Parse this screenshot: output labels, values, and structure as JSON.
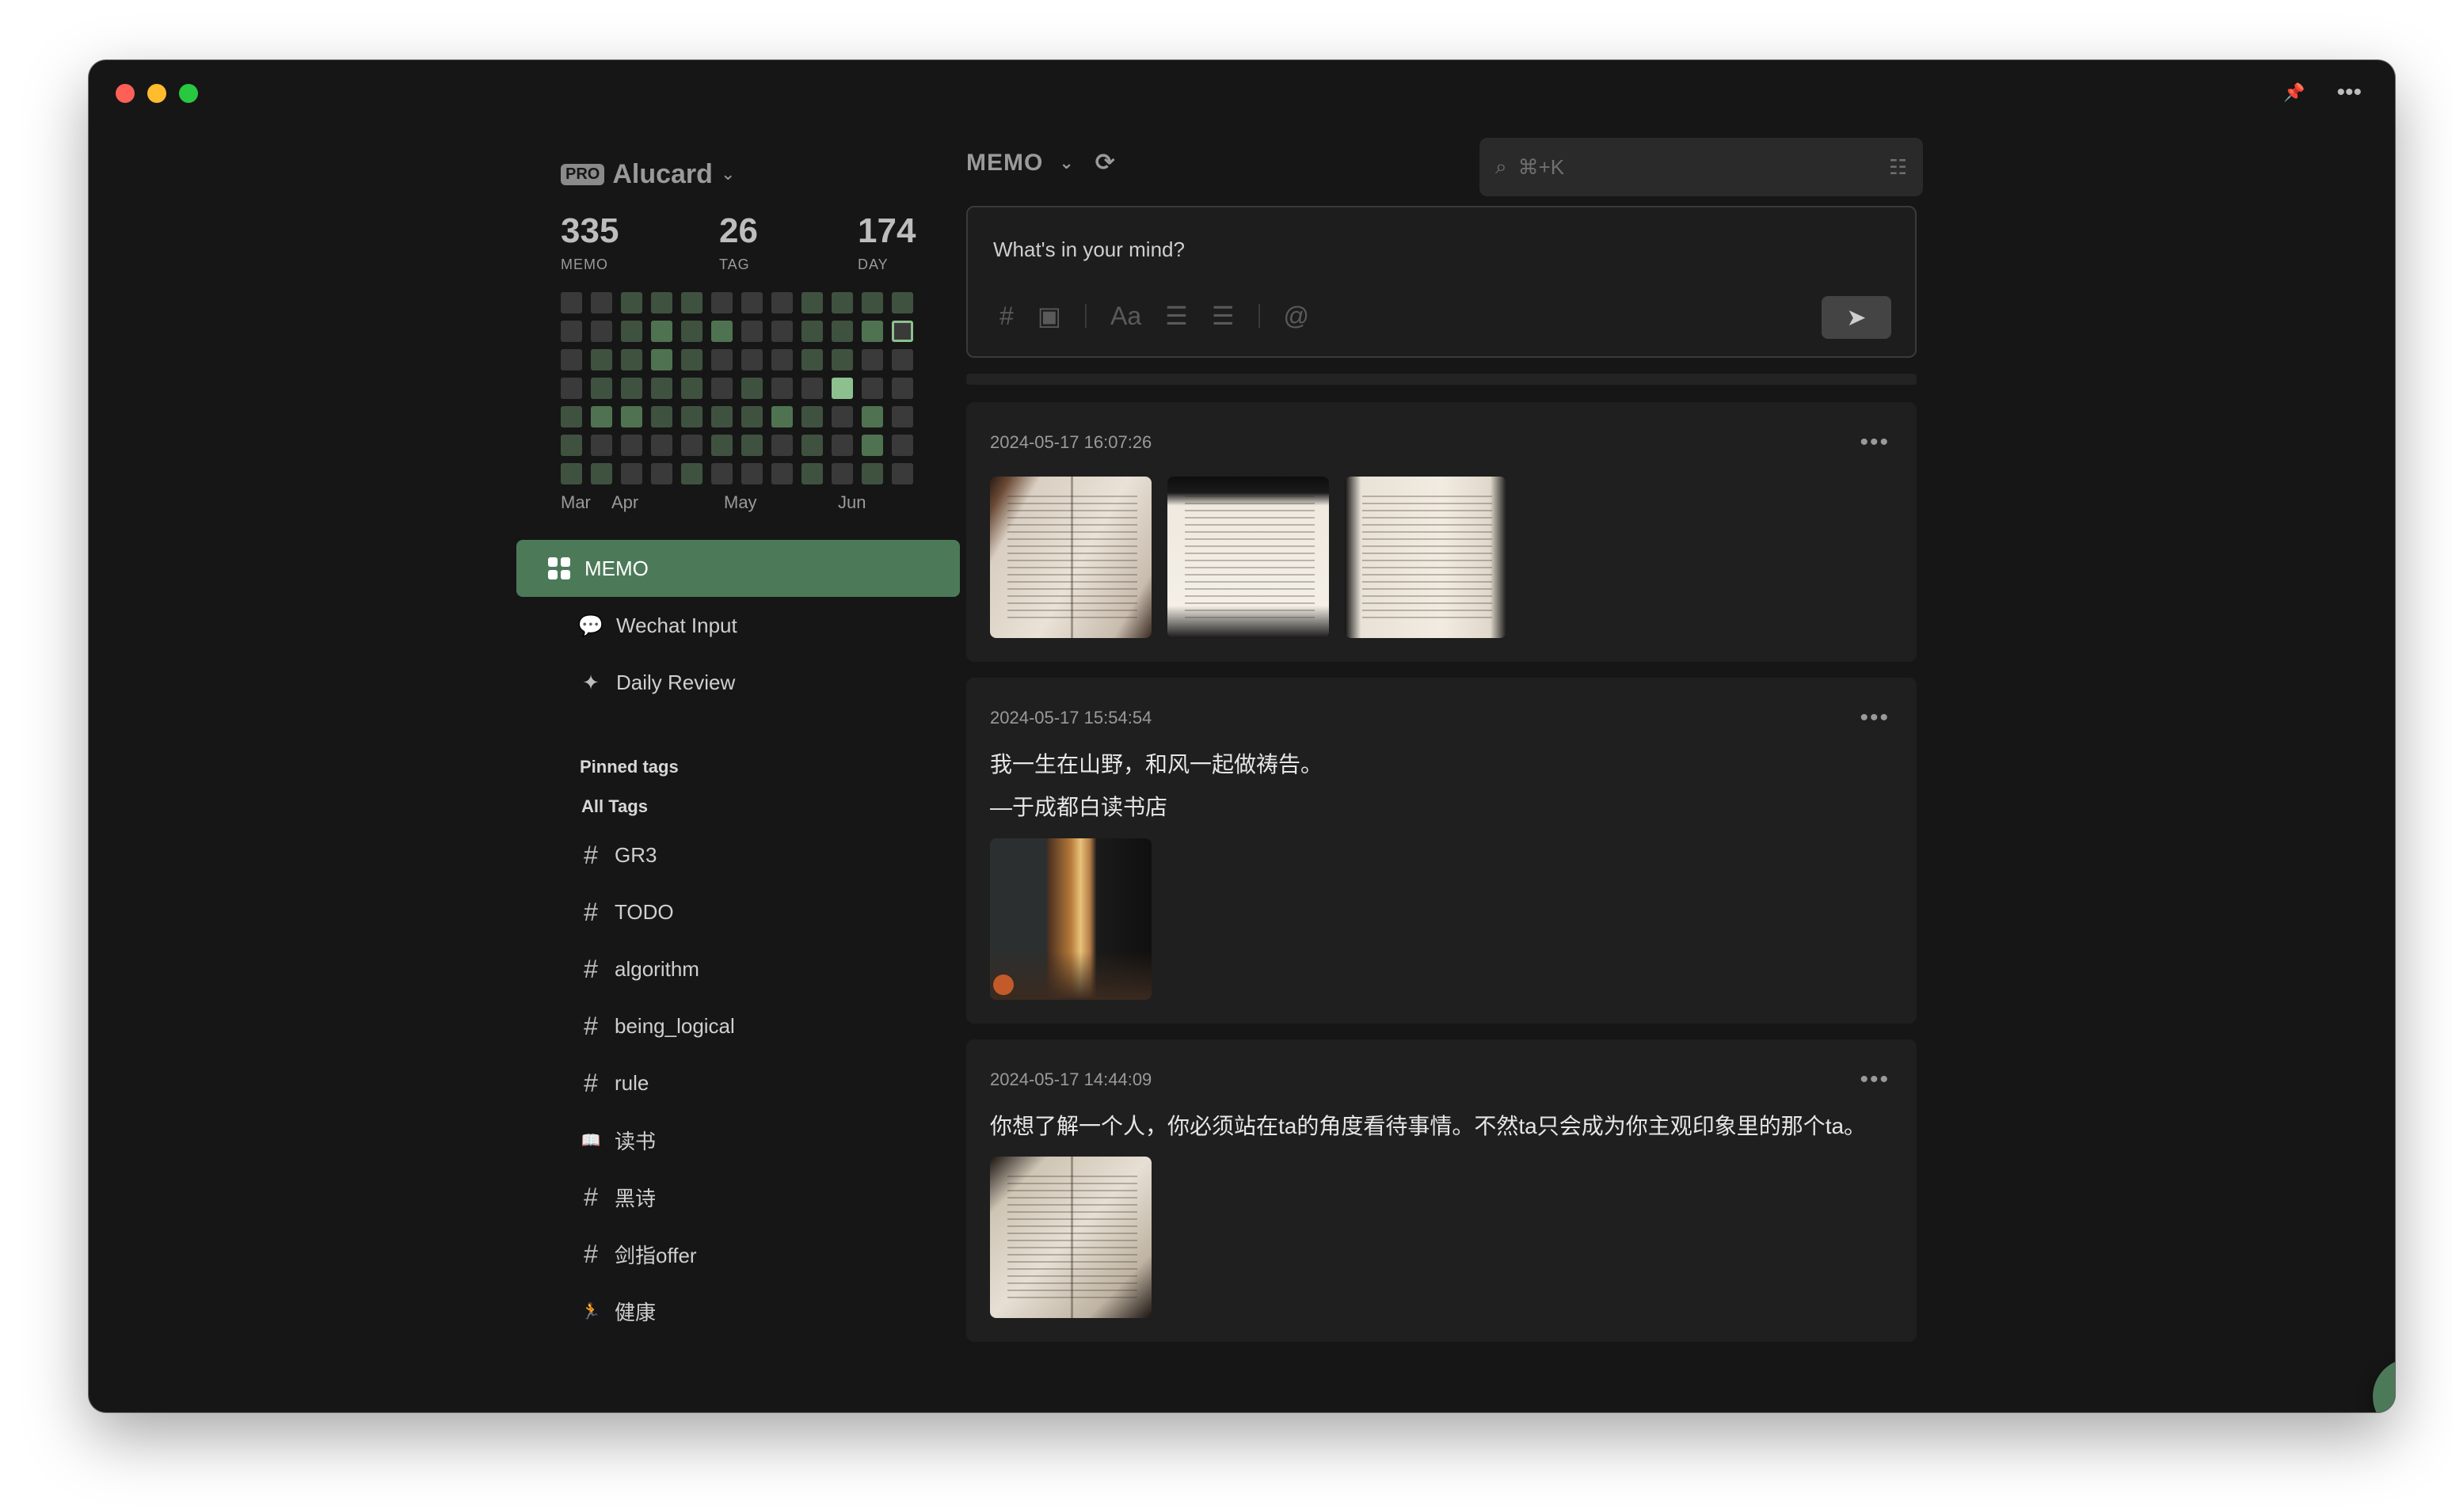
{
  "user": {
    "badge": "PRO",
    "name": "Alucard"
  },
  "stats": [
    {
      "value": "335",
      "label": "MEMO"
    },
    {
      "value": "26",
      "label": "TAG"
    },
    {
      "value": "174",
      "label": "DAY"
    }
  ],
  "heatmap": {
    "levels": [
      0,
      0,
      1,
      1,
      1,
      0,
      0,
      0,
      1,
      1,
      1,
      1,
      0,
      0,
      1,
      2,
      1,
      2,
      0,
      0,
      1,
      1,
      2,
      "t",
      0,
      1,
      1,
      2,
      1,
      0,
      0,
      0,
      1,
      1,
      0,
      0,
      0,
      1,
      1,
      1,
      1,
      0,
      1,
      0,
      0,
      4,
      0,
      0,
      1,
      2,
      2,
      1,
      1,
      1,
      1,
      2,
      1,
      0,
      2,
      0,
      1,
      0,
      0,
      0,
      0,
      1,
      1,
      0,
      1,
      0,
      2,
      0,
      1,
      1,
      0,
      0,
      1,
      0,
      0,
      0,
      1,
      0,
      1,
      0
    ],
    "months": [
      "Mar",
      "Apr",
      "May",
      "Jun"
    ]
  },
  "nav": [
    {
      "label": "MEMO",
      "icon": "grid-icon",
      "active": true
    },
    {
      "label": "Wechat Input",
      "icon": "chat-bubble-icon",
      "active": false
    },
    {
      "label": "Daily Review",
      "icon": "sparkle-icon",
      "active": false
    }
  ],
  "pinned_title": "Pinned tags",
  "all_tags_label": "All Tags",
  "tags": [
    {
      "icon": "#",
      "label": "GR3"
    },
    {
      "icon": "#",
      "label": "TODO"
    },
    {
      "icon": "#",
      "label": "algorithm"
    },
    {
      "icon": "#",
      "label": "being_logical"
    },
    {
      "icon": "#",
      "label": "rule"
    },
    {
      "icon": "📖",
      "label": "读书"
    },
    {
      "icon": "#",
      "label": "黑诗"
    },
    {
      "icon": "#",
      "label": "剑指offer"
    },
    {
      "icon": "🏃",
      "label": "健康"
    }
  ],
  "header": {
    "title": "MEMO",
    "search_placeholder": "⌘+K"
  },
  "composer": {
    "placeholder": "What's in your mind?"
  },
  "memos": [
    {
      "date": "2024-05-17 16:07:26",
      "text": [],
      "images": [
        "book",
        "book b2",
        "book b3"
      ]
    },
    {
      "date": "2024-05-17 15:54:54",
      "text": [
        "我一生在山野，和风一起做祷告。",
        "—于成都白读书店"
      ],
      "images": [
        "room"
      ]
    },
    {
      "date": "2024-05-17 14:44:09",
      "text": [
        "你想了解一个人，你必须站在ta的角度看待事情。不然ta只会成为你主观印象里的那个ta。"
      ],
      "images": [
        "book b4"
      ]
    }
  ],
  "colors": {
    "accent": "#4c7a59",
    "background": "#161616",
    "card": "#1f1f1f"
  }
}
